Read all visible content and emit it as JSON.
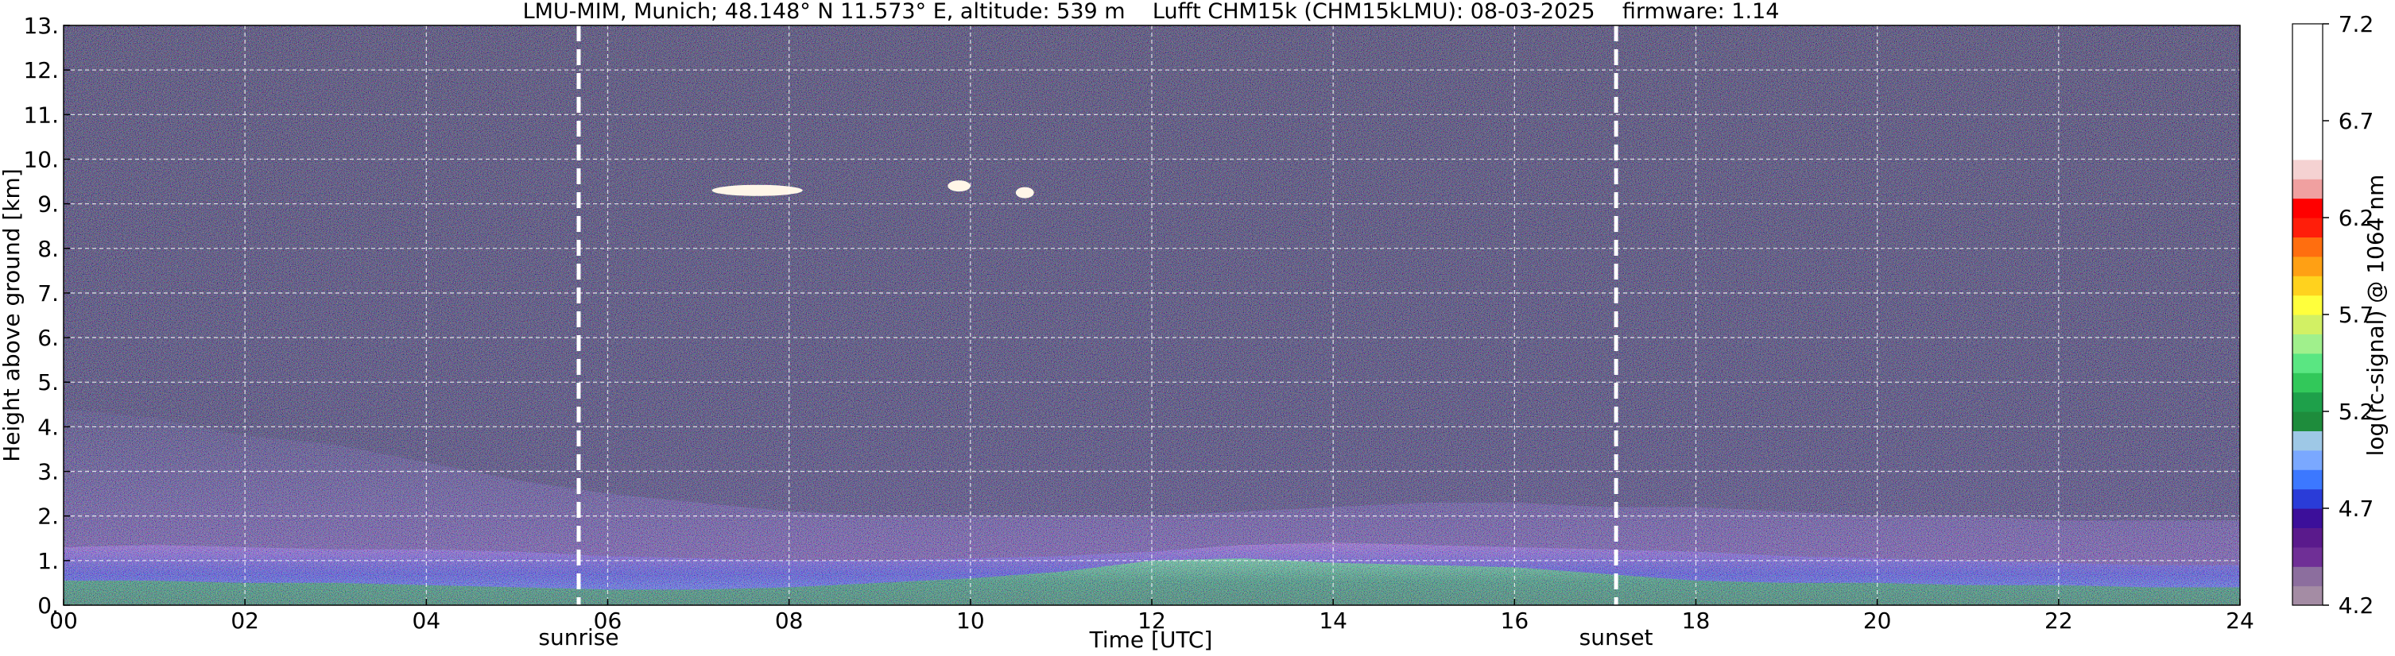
{
  "chart_data": {
    "type": "heatmap",
    "title": "LMU-MIM, Munich; 48.148° N 11.573° E, altitude: 539 m    Lufft CHM15k (CHM15kLMU): 08-03-2025    firmware: 1.14",
    "xlabel": "Time [UTC]",
    "ylabel": "Height above ground [km]",
    "colorbar_label": "log(rc-signal) @ 1064 nm",
    "xlim": [
      0,
      24
    ],
    "ylim": [
      0,
      13
    ],
    "xticks": [
      "00",
      "02",
      "04",
      "06",
      "08",
      "10",
      "12",
      "14",
      "16",
      "18",
      "20",
      "22",
      "24"
    ],
    "yticks": [
      "0.",
      "1.",
      "2.",
      "3.",
      "4.",
      "5.",
      "6.",
      "7.",
      "8.",
      "9.",
      "10.",
      "11.",
      "12.",
      "13."
    ],
    "colorbar_range": [
      4.2,
      7.2
    ],
    "colorbar_ticks": [
      "4.2",
      "4.7",
      "5.2",
      "5.7",
      "6.2",
      "6.7",
      "7.2"
    ],
    "grid": true,
    "colorbar_colors": [
      "#a48ca4",
      "#8c6e9e",
      "#6f2f96",
      "#5a1a8c",
      "#3c0f9a",
      "#2a3cd8",
      "#3c78ff",
      "#7aa8ff",
      "#9ec8e6",
      "#1e8c3c",
      "#1ea04a",
      "#32c85a",
      "#5ae682",
      "#a0f08c",
      "#d2f064",
      "#ffff3c",
      "#ffd21e",
      "#ffa014",
      "#ff6e0f",
      "#ff1e0a",
      "#ff0000",
      "#f0a0a0",
      "#f5d2d2",
      "#ffffff",
      "#ffffff",
      "#ffffff",
      "#ffffff",
      "#ffffff",
      "#ffffff",
      "#ffffff"
    ],
    "markers": [
      {
        "label": "sunrise",
        "x": 5.68
      },
      {
        "label": "sunset",
        "x": 17.12
      }
    ],
    "layers": {
      "boundary_layer_top_km": [
        1.3,
        1.35,
        1.3,
        1.25,
        1.25,
        1.2,
        1.1,
        1.05,
        1.0,
        1.0,
        1.05,
        1.1,
        1.2,
        1.35,
        1.4,
        1.35,
        1.3,
        1.25,
        1.2,
        1.1,
        1.05,
        1.0,
        0.95,
        0.9,
        0.9
      ],
      "green_layer_top_km": [
        0.55,
        0.55,
        0.5,
        0.5,
        0.45,
        0.4,
        0.35,
        0.35,
        0.4,
        0.5,
        0.6,
        0.75,
        1.0,
        1.05,
        0.95,
        0.9,
        0.85,
        0.7,
        0.55,
        0.5,
        0.5,
        0.45,
        0.45,
        0.4,
        0.4
      ],
      "residual_layer_top_km": [
        4.4,
        4.2,
        3.8,
        3.6,
        3.2,
        2.8,
        2.5,
        2.3,
        2.1,
        2.0,
        2.0,
        2.0,
        2.0,
        2.1,
        2.2,
        2.3,
        2.3,
        2.2,
        2.2,
        2.1,
        2.0,
        2.0,
        1.9,
        1.9,
        1.9
      ],
      "clouds": [
        {
          "x": [
            7.15,
            8.15
          ],
          "height_km": 9.3
        },
        {
          "x": [
            9.75,
            10.0
          ],
          "height_km": 9.4
        },
        {
          "x": [
            10.5,
            10.7
          ],
          "height_km": 9.25
        }
      ]
    }
  }
}
